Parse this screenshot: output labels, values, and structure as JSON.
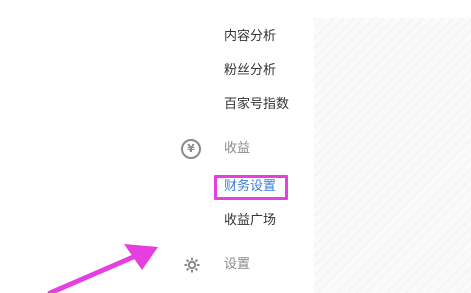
{
  "sidebar": {
    "items": [
      {
        "label": "内容分析"
      },
      {
        "label": "粉丝分析"
      },
      {
        "label": "百家号指数"
      }
    ],
    "income_group": {
      "label": "收益",
      "icon": "yen-circle-icon",
      "items": [
        {
          "label": "财务设置",
          "active": true
        },
        {
          "label": "收益广场"
        }
      ]
    },
    "settings_group": {
      "label": "设置",
      "icon": "gear-icon"
    }
  },
  "colors": {
    "active_text": "#3b7dd8",
    "highlight_border": "#e63fe0",
    "arrow": "#e63fe0",
    "muted_text": "#8a8a8a"
  }
}
